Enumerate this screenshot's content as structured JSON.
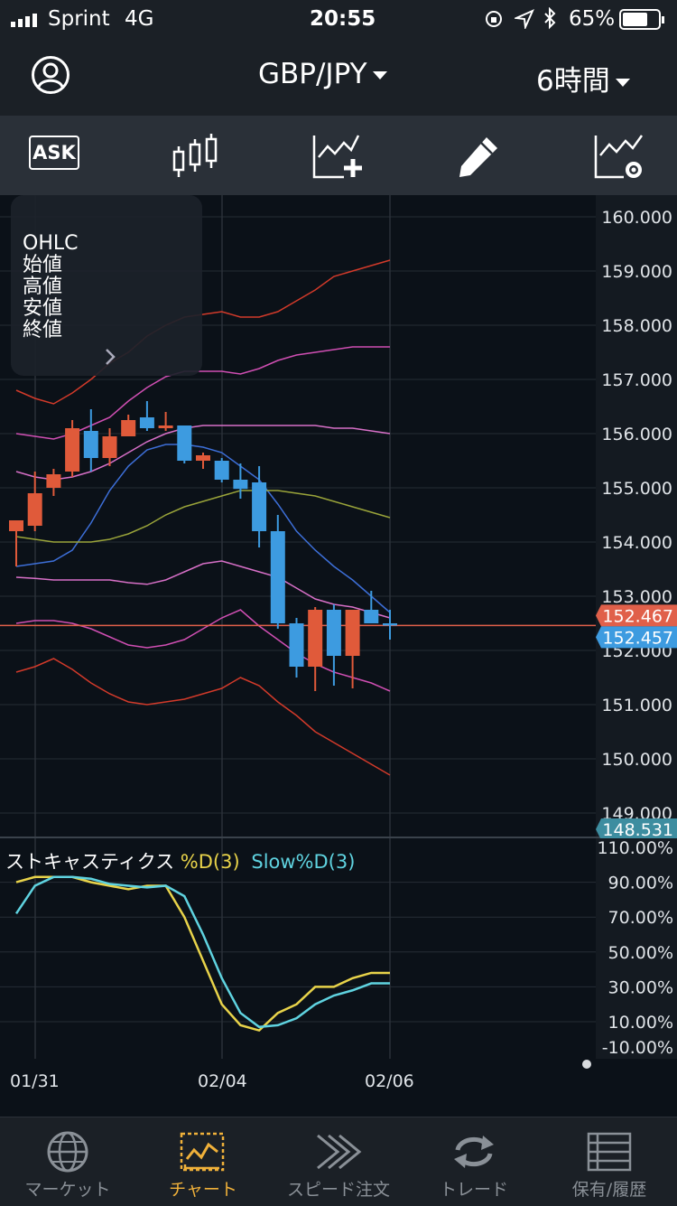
{
  "status_bar": {
    "carrier": "Sprint",
    "network": "4G",
    "time": "20:55",
    "battery": "65%"
  },
  "header": {
    "pair": "GBP/JPY",
    "timeframe": "6時間"
  },
  "toolbar": {
    "ask_label": "ASK"
  },
  "ohlc_panel": {
    "title": "OHLC",
    "open": "始値",
    "high": "高値",
    "low": "安値",
    "close": "終値"
  },
  "price_axis": {
    "ticks": [
      "160.000",
      "159.000",
      "158.000",
      "157.000",
      "156.000",
      "155.000",
      "154.000",
      "153.000",
      "152.000",
      "151.000",
      "150.000",
      "149.000"
    ],
    "bid_tag": "152.467",
    "ask_tag": "152.457",
    "bottom_tag": "148.531"
  },
  "stoch": {
    "title": "ストキャスティクス",
    "d_label": "%D(3)",
    "slow_label": "Slow%D(3)",
    "ticks": [
      "110.00%",
      "90.00%",
      "70.00%",
      "50.00%",
      "30.00%",
      "10.00%",
      "-10.00%"
    ]
  },
  "dates": [
    "01/31",
    "02/04",
    "02/06"
  ],
  "tabs": [
    {
      "label": "マーケット"
    },
    {
      "label": "チャート"
    },
    {
      "label": "スピード注文"
    },
    {
      "label": "トレード"
    },
    {
      "label": "保有/履歴"
    }
  ],
  "colors": {
    "up": "#e05a3a",
    "down": "#3d9be0",
    "accent": "#f0b13a",
    "bid": "#e0604a",
    "ask": "#3d9be0"
  },
  "chart_data": {
    "type": "candlestick",
    "ylim": [
      148.531,
      160.4
    ],
    "candles": [
      {
        "o": 154.2,
        "h": 154.4,
        "l": 153.55,
        "c": 154.4
      },
      {
        "o": 154.3,
        "h": 155.3,
        "l": 154.2,
        "c": 154.9
      },
      {
        "o": 155.0,
        "h": 155.35,
        "l": 154.85,
        "c": 155.25
      },
      {
        "o": 155.3,
        "h": 156.25,
        "l": 155.2,
        "c": 156.1
      },
      {
        "o": 156.05,
        "h": 156.45,
        "l": 155.3,
        "c": 155.55
      },
      {
        "o": 155.55,
        "h": 156.1,
        "l": 155.4,
        "c": 155.95
      },
      {
        "o": 155.95,
        "h": 156.35,
        "l": 155.95,
        "c": 156.25
      },
      {
        "o": 156.3,
        "h": 156.6,
        "l": 156.05,
        "c": 156.1
      },
      {
        "o": 156.1,
        "h": 156.4,
        "l": 156.05,
        "c": 156.15
      },
      {
        "o": 156.15,
        "h": 156.15,
        "l": 155.45,
        "c": 155.5
      },
      {
        "o": 155.5,
        "h": 155.65,
        "l": 155.35,
        "c": 155.6
      },
      {
        "o": 155.5,
        "h": 155.55,
        "l": 155.1,
        "c": 155.15
      },
      {
        "o": 155.15,
        "h": 155.45,
        "l": 154.8,
        "c": 154.98
      },
      {
        "o": 155.1,
        "h": 155.4,
        "l": 153.9,
        "c": 154.2
      },
      {
        "o": 154.2,
        "h": 154.5,
        "l": 152.4,
        "c": 152.5
      },
      {
        "o": 152.5,
        "h": 152.6,
        "l": 151.5,
        "c": 151.7
      },
      {
        "o": 151.7,
        "h": 152.8,
        "l": 151.25,
        "c": 152.75
      },
      {
        "o": 152.75,
        "h": 152.85,
        "l": 151.35,
        "c": 151.9
      },
      {
        "o": 151.9,
        "h": 152.75,
        "l": 151.3,
        "c": 152.75
      },
      {
        "o": 152.75,
        "h": 153.1,
        "l": 152.5,
        "c": 152.5
      },
      {
        "o": 152.5,
        "h": 152.75,
        "l": 152.2,
        "c": 152.46
      }
    ],
    "bands": {
      "outer_upper": [
        156.8,
        156.65,
        156.55,
        156.75,
        157.0,
        157.3,
        157.5,
        157.8,
        158.0,
        158.15,
        158.2,
        158.25,
        158.15,
        158.15,
        158.25,
        158.45,
        158.65,
        158.9,
        159.0,
        159.1,
        159.2
      ],
      "inner_upper": [
        156.0,
        155.95,
        155.9,
        156.0,
        156.15,
        156.3,
        156.6,
        156.85,
        157.05,
        157.15,
        157.15,
        157.15,
        157.1,
        157.2,
        157.35,
        157.45,
        157.5,
        157.55,
        157.6,
        157.6,
        157.6
      ],
      "upper": [
        155.3,
        155.2,
        155.15,
        155.2,
        155.3,
        155.45,
        155.65,
        155.85,
        156.0,
        156.1,
        156.15,
        156.15,
        156.15,
        156.15,
        156.15,
        156.15,
        156.15,
        156.1,
        156.1,
        156.05,
        156.0
      ],
      "middle": [
        153.55,
        153.6,
        153.65,
        153.85,
        154.35,
        154.95,
        155.4,
        155.7,
        155.8,
        155.8,
        155.75,
        155.65,
        155.4,
        155.15,
        154.7,
        154.2,
        153.85,
        153.55,
        153.3,
        153.0,
        152.7
      ],
      "ma": [
        154.1,
        154.05,
        154.0,
        154.0,
        154.0,
        154.05,
        154.15,
        154.3,
        154.5,
        154.65,
        154.75,
        154.85,
        154.95,
        154.95,
        154.95,
        154.9,
        154.85,
        154.75,
        154.65,
        154.55,
        154.45
      ],
      "lower_inner": [
        153.35,
        153.33,
        153.3,
        153.3,
        153.3,
        153.3,
        153.25,
        153.22,
        153.3,
        153.45,
        153.6,
        153.65,
        153.55,
        153.45,
        153.35,
        153.15,
        152.95,
        152.85,
        152.8,
        152.7,
        152.6
      ],
      "lower": [
        152.5,
        152.55,
        152.55,
        152.5,
        152.4,
        152.25,
        152.1,
        152.05,
        152.1,
        152.2,
        152.4,
        152.6,
        152.75,
        152.45,
        152.2,
        151.95,
        151.75,
        151.6,
        151.5,
        151.4,
        151.25
      ],
      "outer_lower": [
        151.6,
        151.7,
        151.85,
        151.65,
        151.4,
        151.2,
        151.05,
        151.0,
        151.05,
        151.1,
        151.2,
        151.3,
        151.5,
        151.35,
        151.05,
        150.8,
        150.5,
        150.3,
        150.1,
        149.9,
        149.7
      ]
    },
    "stoch_d": [
      90,
      93,
      93,
      93,
      90,
      88,
      86,
      88,
      88,
      70,
      45,
      20,
      8,
      5,
      15,
      20,
      30,
      30,
      35,
      38,
      38
    ],
    "stoch_slow": [
      72,
      88,
      93,
      93,
      92,
      89,
      88,
      87,
      88,
      82,
      60,
      35,
      15,
      7,
      8,
      12,
      20,
      25,
      28,
      32,
      32
    ]
  }
}
